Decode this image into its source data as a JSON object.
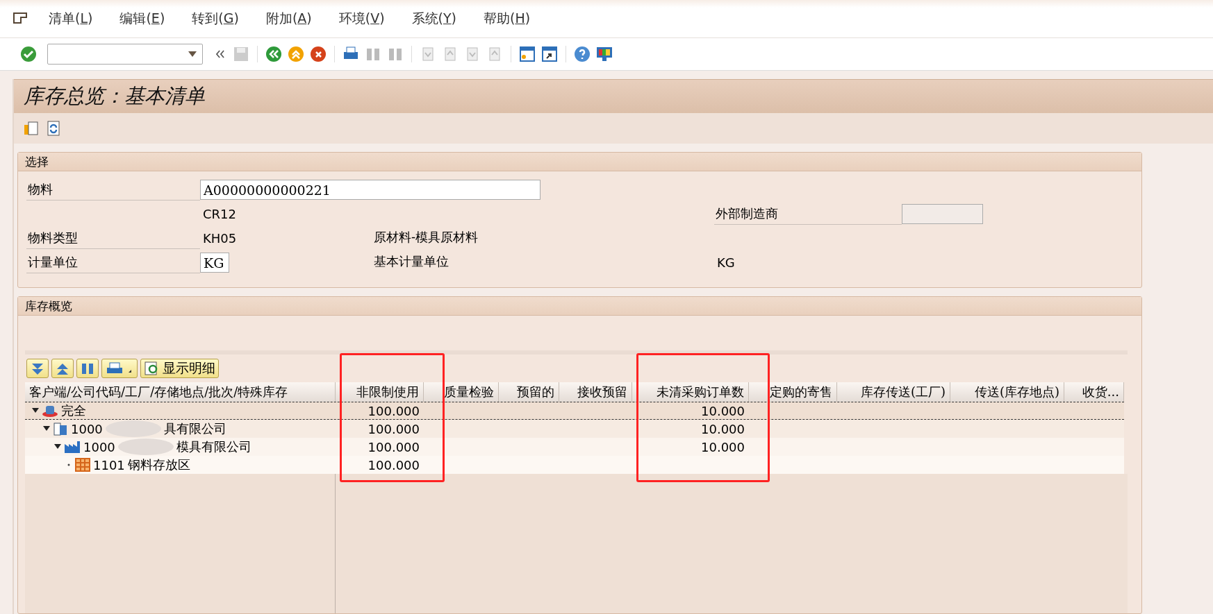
{
  "menu": [
    {
      "prefix": "清单(",
      "key": "L",
      "suffix": ")"
    },
    {
      "prefix": "编辑(",
      "key": "E",
      "suffix": ")"
    },
    {
      "prefix": "转到(",
      "key": "G",
      "suffix": ")"
    },
    {
      "prefix": "附加(",
      "key": "A",
      "suffix": ")"
    },
    {
      "prefix": "环境(",
      "key": "V",
      "suffix": ")"
    },
    {
      "prefix": "系统(",
      "key": "Y",
      "suffix": ")"
    },
    {
      "prefix": "帮助(",
      "key": "H",
      "suffix": ")"
    }
  ],
  "title": "库存总览：基本清单",
  "selection": {
    "title": "选择",
    "material": {
      "label": "物料",
      "value": "A00000000000221",
      "description": "CR12"
    },
    "manufacturer": {
      "label": "外部制造商"
    },
    "material_type": {
      "label": "物料类型",
      "code": "KH05",
      "text": "原材料-模具原材料"
    },
    "unit": {
      "label": "计量单位",
      "value": "KG",
      "base_label": "基本计量单位",
      "base_value": "KG"
    }
  },
  "overview": {
    "title": "库存概览",
    "detail_button": "显示明细",
    "columns": [
      {
        "label": "客户端/公司代码/工厂/存储地点/批次/特殊库存",
        "highlighted": false
      },
      {
        "label": "非限制使用",
        "highlighted": true
      },
      {
        "label": "质量检验",
        "highlighted": false
      },
      {
        "label": "预留的",
        "highlighted": false
      },
      {
        "label": "接收预留",
        "highlighted": false
      },
      {
        "label": "未清采购订单数",
        "highlighted": true
      },
      {
        "label": "定购的寄售",
        "highlighted": false
      },
      {
        "label": "库存传送(工厂)",
        "highlighted": false
      },
      {
        "label": "传送(库存地点)",
        "highlighted": false
      },
      {
        "label": "收货...",
        "highlighted": false
      }
    ],
    "tree": [
      {
        "kind": "client",
        "code": "完全",
        "blurred": false,
        "selected": true,
        "expanded": true,
        "non_restricted_use": "100.000",
        "open_po_quantity": "10.000",
        "children": [
          {
            "kind": "company",
            "code": "1000",
            "name": "具有限公司",
            "blurred": true,
            "selected": false,
            "expanded": true,
            "non_restricted_use": "100.000",
            "open_po_quantity": "10.000",
            "children": [
              {
                "kind": "plant",
                "code": "1000",
                "name": "模具有限公司",
                "blurred": true,
                "selected": false,
                "expanded": true,
                "non_restricted_use": "100.000",
                "open_po_quantity": "10.000",
                "children": [
                  {
                    "kind": "storage",
                    "code": "1101",
                    "name": "钢料存放区",
                    "blurred": false,
                    "selected": false,
                    "expanded": false,
                    "non_restricted_use": "100.000"
                  }
                ]
              }
            ]
          }
        ]
      }
    ]
  }
}
